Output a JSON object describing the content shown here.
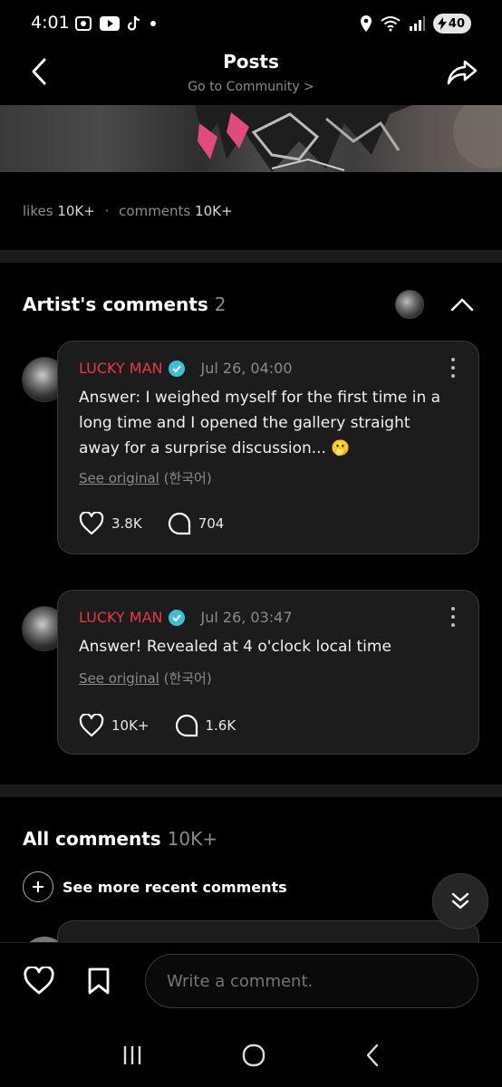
{
  "status_bar": {
    "time": "4:01",
    "battery": "40",
    "icons_left": [
      "screen-record-icon",
      "youtube-icon",
      "tiktok-icon",
      "dot-icon"
    ],
    "icons_right": [
      "location-icon",
      "wifi-icon",
      "signal-icon",
      "battery-icon"
    ]
  },
  "header": {
    "title": "Posts",
    "subtitle": "Go to Community >"
  },
  "stats": {
    "likes_label": "likes",
    "likes_value": "10K+",
    "separator": "·",
    "comments_label": "comments",
    "comments_value": "10K+"
  },
  "artist_comments": {
    "title": "Artist's comments",
    "count": "2",
    "comments": [
      {
        "author": "LUCKY MAN",
        "date": "Jul 26, 04:00",
        "body": "Answer: I weighed myself for the first time in a long time and I opened the gallery straight away for a surprise discussion... 🫢",
        "see_original": "See original",
        "language": "(한국어)",
        "likes": "3.8K",
        "replies": "704"
      },
      {
        "author": "LUCKY MAN",
        "date": "Jul 26, 03:47",
        "body": "Answer! Revealed at 4 o'clock local time",
        "see_original": "See original",
        "language": "(한국어)",
        "likes": "10K+",
        "replies": "1.6K"
      }
    ]
  },
  "all_comments": {
    "title": "All comments",
    "count": "10K+",
    "see_more": "See more recent comments"
  },
  "composer": {
    "placeholder": "Write a comment."
  },
  "colors": {
    "background": "#000000",
    "card": "#1c1c1c",
    "author_name": "#e63946",
    "verified": "#3cc0d8",
    "muted": "#8a8a8a"
  }
}
